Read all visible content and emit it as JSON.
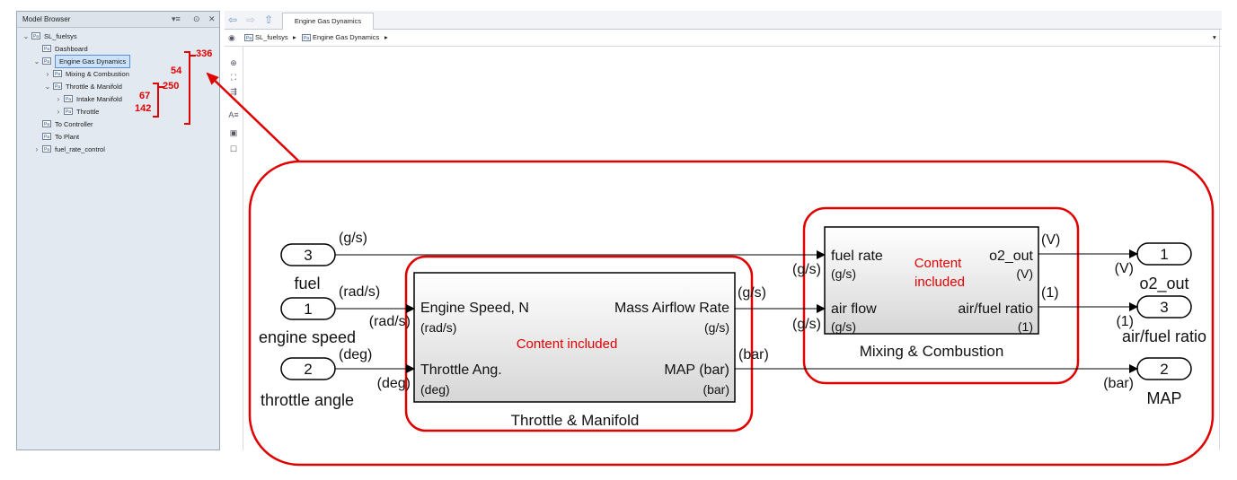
{
  "browser": {
    "title": "Model Browser",
    "menu_icon": "▾≡",
    "view_icon": "⊙",
    "close_icon": "✕",
    "tree": [
      {
        "label": "SL_fuelsys",
        "chevron": "⌄"
      },
      {
        "label": "Dashboard",
        "chevron": ""
      },
      {
        "label": "Engine Gas Dynamics",
        "chevron": "⌄"
      },
      {
        "label": "Mixing & Combustion",
        "chevron": "›"
      },
      {
        "label": "Throttle & Manifold",
        "chevron": "⌄"
      },
      {
        "label": "Intake Manifold",
        "chevron": "›"
      },
      {
        "label": "Throttle",
        "chevron": "›"
      },
      {
        "label": "To Controller",
        "chevron": ""
      },
      {
        "label": "To Plant",
        "chevron": ""
      },
      {
        "label": "fuel_rate_control",
        "chevron": "›"
      }
    ],
    "block_glyph": "Pa",
    "counts": {
      "engine_gas_dynamics": "336",
      "mixing": "54",
      "throttle_manifold": "250",
      "intake": "67",
      "throttle": "142"
    }
  },
  "editor": {
    "tab_label": "Engine Gas Dynamics",
    "back_icon": "⇦",
    "forward_icon": "⇨",
    "up_icon": "⇧",
    "breadcrumb": [
      "SL_fuelsys",
      "Engine Gas Dynamics"
    ],
    "crumb_sep": "▸",
    "dropdown_icon": "▾",
    "tools": [
      "⊕",
      "🔍",
      "⛶",
      "⇶",
      "A≡",
      "▣",
      "☐"
    ],
    "colors": {
      "accent_red": "#e00000",
      "selection": "#cce1fa"
    }
  },
  "diagram": {
    "inports": [
      {
        "num": "3",
        "name": "fuel"
      },
      {
        "num": "1",
        "name": "engine speed"
      },
      {
        "num": "2",
        "name": "throttle angle"
      }
    ],
    "outports": [
      {
        "num": "1",
        "name": "o2_out"
      },
      {
        "num": "3",
        "name": "air/fuel ratio"
      },
      {
        "num": "2",
        "name": "MAP"
      }
    ],
    "throttle_block": {
      "name": "Throttle & Manifold",
      "in1": "Engine Speed, N",
      "in1_unit": "(rad/s)",
      "in2": "Throttle Ang.",
      "in2_unit": "(deg)",
      "out1": "Mass Airflow Rate",
      "out1_unit": "(g/s)",
      "out2": "MAP (bar)",
      "out2_unit": "(bar)",
      "note": "Content included"
    },
    "mixing_block": {
      "name": "Mixing & Combustion",
      "in1": "fuel rate",
      "in1_unit": "(g/s)",
      "in2": "air flow",
      "in2_unit": "(g/s)",
      "out1": "o2_out",
      "out1_unit": "(V)",
      "out2": "air/fuel ratio",
      "out2_unit": "(1)",
      "note_line1": "Content",
      "note_line2": "included"
    },
    "signal_labels": {
      "fuel_out": "(g/s)",
      "speed_out": "(rad/s)",
      "speed_in": "(rad/s)",
      "angle_out": "(deg)",
      "angle_in": "(deg)",
      "maf_out": "(g/s)",
      "maf_in": "(g/s)",
      "fuel_in": "(g/s)",
      "map_out": "(bar)",
      "map_in": "(bar)",
      "o2_out": "(V)",
      "o2_in": "(V)",
      "afr_out": "(1)",
      "afr_in": "(1)"
    }
  }
}
